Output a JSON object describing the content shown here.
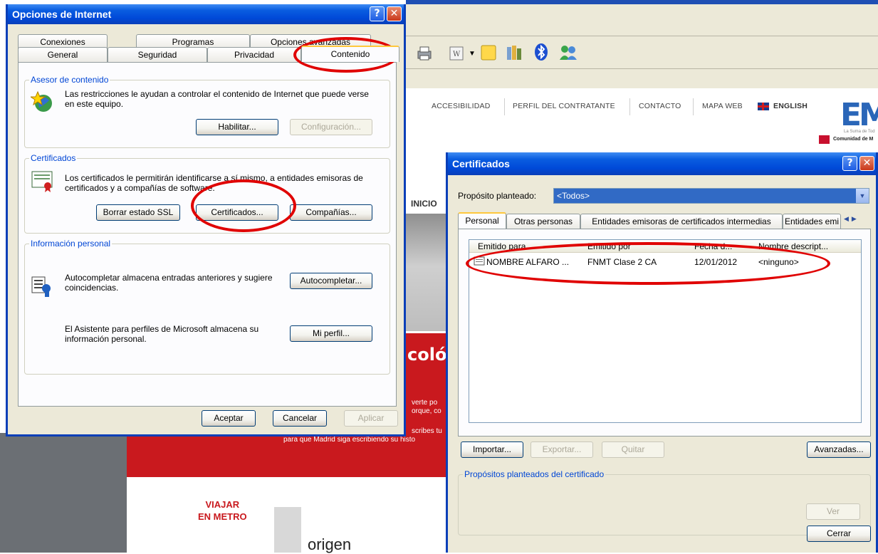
{
  "background_page": {
    "nav_items": [
      "ACCESIBILIDAD",
      "PERFIL DEL CONTRATANTE",
      "CONTACTO",
      "MAPA WEB",
      "ENGLISH"
    ],
    "inicio": "INICIO",
    "hero_heading_fragment": "cológ",
    "hero_lines": [
      "verte po",
      "orque, co",
      "scribes tu",
      "para que Madrid siga escribiendo su histo"
    ],
    "link_line1": "VIAJAR",
    "link_line2": "EN METRO",
    "origen": "origen",
    "logo_fragment": "EM",
    "logo_subtitle": "La Suma de Tod",
    "region_label": "Comunidad de M"
  },
  "internet_options": {
    "title": "Opciones de Internet",
    "tabs_back": [
      "Conexiones",
      "Programas",
      "Opciones avanzadas"
    ],
    "tabs_front": [
      "General",
      "Seguridad",
      "Privacidad",
      "Contenido"
    ],
    "active_tab": "Contenido",
    "content_advisor": {
      "legend": "Asesor de contenido",
      "text": "Las restricciones le ayudan a controlar el contenido de Internet que puede verse en este equipo.",
      "enable_label": "Habilitar...",
      "settings_label": "Configuración..."
    },
    "certificates": {
      "legend": "Certificados",
      "text": "Los certificados le permitirán identificarse a sí mismo, a entidades emisoras de certificados y a compañías de software.",
      "clear_ssl_label": "Borrar estado SSL",
      "certificates_label": "Certificados...",
      "publishers_label": "Compañías..."
    },
    "personal_info": {
      "legend": "Información personal",
      "autocomplete_text": "Autocompletar almacena entradas anteriores y sugiere coincidencias.",
      "autocomplete_label": "Autocompletar...",
      "profile_text": "El Asistente para perfiles de Microsoft almacena su información personal.",
      "profile_label": "Mi perfil..."
    },
    "ok_label": "Aceptar",
    "cancel_label": "Cancelar",
    "apply_label": "Aplicar"
  },
  "certificates_dialog": {
    "title": "Certificados",
    "purpose_label": "Propósito planteado:",
    "purpose_value": "<Todos>",
    "tabs": [
      "Personal",
      "Otras personas",
      "Entidades emisoras de certificados intermedias",
      "Entidades emi"
    ],
    "active_tab": "Personal",
    "columns": [
      "Emitido para",
      "Emitido por",
      "Fecha d...",
      "Nombre descript..."
    ],
    "rows": [
      [
        "NOMBRE ALFARO ...",
        "FNMT Clase 2 CA",
        "12/01/2012",
        "<ninguno>"
      ]
    ],
    "import_label": "Importar...",
    "export_label": "Exportar...",
    "remove_label": "Quitar",
    "advanced_label": "Avanzadas...",
    "purposes_legend": "Propósitos planteados del certificado",
    "view_label": "Ver",
    "close_label": "Cerrar"
  },
  "colors": {
    "xp_title_blue": "#0a3fb8",
    "dialog_face": "#ece9d8",
    "group_legend": "#0046d5",
    "annotation_red": "#e00000",
    "site_red": "#c9191e",
    "selection_blue": "#316ac5"
  }
}
